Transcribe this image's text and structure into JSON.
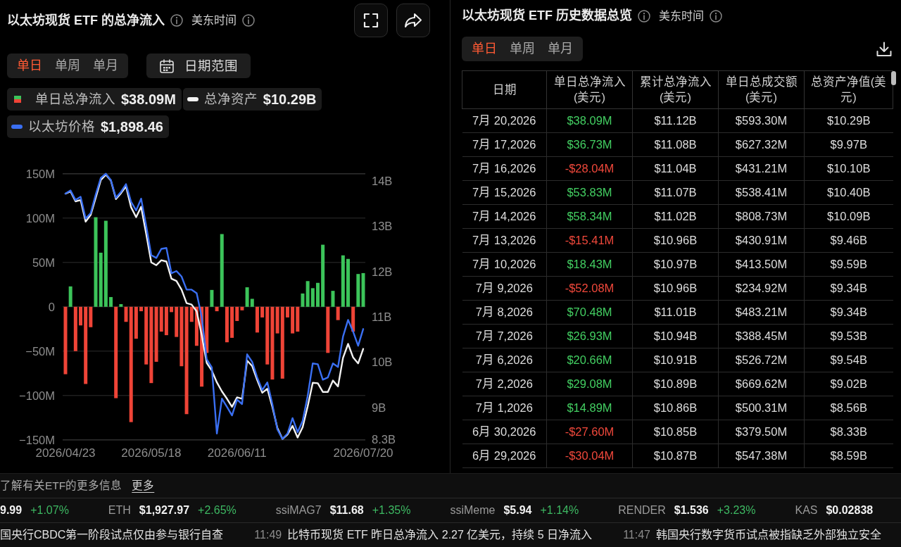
{
  "chart_panel": {
    "title": "以太坊现货 ETF 的总净流入",
    "timezone_label": "美东时间",
    "period_tabs": [
      {
        "label": "单日",
        "selected": true
      },
      {
        "label": "单周",
        "selected": false
      },
      {
        "label": "单月",
        "selected": false
      }
    ],
    "date_range_button": "日期范围",
    "legend": [
      {
        "kind": "bar",
        "label": "单日总净流入",
        "value": "$38.09M"
      },
      {
        "kind": "line",
        "label": "总净资产",
        "value": "$10.29B",
        "color": "#f2f2f2"
      },
      {
        "kind": "line",
        "label": "以太坊价格",
        "value": "$1,898.46",
        "color": "#3a6ff2"
      }
    ],
    "bar_chart": {
      "chart_data": {
        "type": "bar",
        "grid": true,
        "categories": [
          "2026/04/23",
          null,
          null,
          null,
          null,
          null,
          null,
          null,
          null,
          null,
          null,
          null,
          null,
          null,
          null,
          null,
          null,
          "2026/05/18",
          null,
          null,
          null,
          null,
          null,
          null,
          null,
          null,
          null,
          null,
          null,
          null,
          null,
          null,
          null,
          null,
          "2026/06/11",
          null,
          null,
          null,
          null,
          null,
          null,
          null,
          null,
          null,
          null,
          null,
          null,
          null,
          null,
          null,
          null,
          null,
          null,
          null,
          null,
          null,
          null,
          null,
          null,
          "2026/07/20"
        ],
        "ylim": [
          -150,
          150
        ],
        "yticks": [
          {
            "value": 150,
            "label": "150M"
          },
          {
            "value": 100,
            "label": "100M"
          },
          {
            "value": 50,
            "label": "50M"
          },
          {
            "value": 0,
            "label": "0"
          },
          {
            "value": -50,
            "label": "−50M"
          },
          {
            "value": -100,
            "label": "−100M"
          },
          {
            "value": -150,
            "label": "−150M"
          }
        ],
        "series": [
          {
            "color": "#3cc45a",
            "values": [
              null,
              23,
              null,
              null,
              null,
              null,
              101,
              61,
              97,
              11,
              null,
              3,
              null,
              null,
              null,
              null,
              null,
              null,
              null,
              null,
              null,
              null,
              null,
              null,
              null,
              null,
              null,
              null,
              null,
              19,
              null,
              82,
              null,
              null,
              null,
              null,
              22,
              9,
              null,
              null,
              null,
              null,
              null,
              null,
              null,
              null,
              null,
              15,
              29,
              21,
              27,
              70,
              null,
              18,
              null,
              58,
              54,
              null,
              37,
              38
            ]
          },
          {
            "color": "#ef4437",
            "values": [
              -76,
              null,
              -50,
              -21,
              -87,
              -23,
              null,
              null,
              null,
              null,
              -103,
              null,
              -17,
              -130,
              -36,
              -5,
              -65,
              -86,
              -62,
              -28,
              -32,
              -6,
              -34,
              -67,
              -121,
              -17,
              -44,
              -90,
              -52,
              null,
              -5,
              null,
              -40,
              -35,
              -16,
              -4,
              null,
              null,
              -29,
              -12,
              -65,
              -82,
              -30,
              -81,
              -12,
              -30,
              -28,
              null,
              null,
              null,
              null,
              null,
              -52,
              null,
              -15,
              null,
              null,
              -28,
              null,
              null
            ]
          }
        ]
      }
    },
    "line_chart": {
      "chart_data": {
        "type": "line",
        "categories": [
          null,
          null,
          null,
          null,
          null,
          null,
          null,
          null,
          null,
          null,
          null,
          null,
          null,
          null,
          null,
          null,
          null,
          null,
          null,
          null,
          null,
          null,
          null,
          null,
          null,
          null,
          null,
          null,
          null,
          null,
          null,
          null,
          null,
          null,
          null,
          null,
          null,
          null,
          null,
          null,
          null,
          null,
          null,
          null,
          null,
          null,
          null,
          null,
          null,
          null,
          null,
          null,
          null,
          null,
          null,
          null,
          null,
          null,
          null,
          null
        ],
        "ylim": [
          8.28,
          14.16
        ],
        "yticks": [
          {
            "value": 14,
            "label": "14B"
          },
          {
            "value": 13,
            "label": "13B"
          },
          {
            "value": 12,
            "label": "12B"
          },
          {
            "value": 11,
            "label": "11B"
          },
          {
            "value": 10,
            "label": "10B"
          },
          {
            "value": 9,
            "label": "9B"
          },
          {
            "value": 8.3,
            "label": "8.3B"
          }
        ],
        "series": [
          {
            "color": "#f2f2f2",
            "values": [
              13.72,
              13.77,
              13.55,
              13.58,
              13.1,
              13.25,
              13.63,
              14.02,
              14.14,
              14.01,
              13.6,
              13.73,
              13.88,
              13.42,
              13.2,
              13.43,
              12.83,
              12.2,
              12.14,
              12.25,
              12.22,
              11.84,
              11.79,
              11.6,
              11.3,
              11.27,
              11.12,
              10.59,
              9.98,
              9.81,
              9.55,
              9.35,
              9.19,
              9.01,
              9.22,
              9.19,
              10.03,
              9.91,
              9.6,
              9.32,
              9.41,
              9.01,
              8.54,
              8.3,
              8.4,
              8.59,
              8.33,
              8.56,
              9.02,
              9.54,
              9.53,
              9.34,
              9.34,
              9.59,
              9.46,
              10.09,
              10.4,
              10.1,
              9.97,
              10.29
            ]
          },
          {
            "color": "#3a6ff2",
            "values": [
              13.72,
              13.79,
              13.58,
              13.65,
              13.17,
              13.29,
              13.7,
              14.07,
              14.16,
              14.02,
              13.63,
              13.76,
              13.93,
              13.54,
              13.35,
              13.61,
              13.01,
              12.36,
              12.3,
              12.5,
              12.52,
              11.96,
              12.01,
              11.89,
              11.6,
              11.6,
              11.52,
              10.99,
              10.06,
              9.88,
              8.42,
              9.19,
              9.01,
              8.82,
              9.17,
              9.07,
              10.17,
              10.0,
              9.66,
              9.38,
              9.55,
              9.07,
              8.51,
              8.3,
              8.42,
              8.76,
              8.45,
              8.7,
              9.25,
              9.97,
              9.95,
              9.61,
              9.66,
              9.97,
              9.89,
              10.56,
              10.93,
              10.67,
              10.36,
              10.73
            ]
          }
        ]
      }
    }
  },
  "history_panel": {
    "title": "以太坊现货 ETF 历史数据总览",
    "timezone_label": "美东时间",
    "period_tabs": [
      {
        "label": "单日",
        "selected": true
      },
      {
        "label": "单周",
        "selected": false
      },
      {
        "label": "单月",
        "selected": false
      }
    ],
    "table": {
      "columns": [
        "日期",
        "单日总净流入(美元)",
        "累计总净流入(美元)",
        "单日总成交额(美元)",
        "总资产净值(美元)"
      ],
      "rows": [
        {
          "outflow": false,
          "cells": [
            "7月 20,2026",
            "$38.09M",
            "$11.12B",
            "$593.30M",
            "$10.29B"
          ]
        },
        {
          "outflow": false,
          "cells": [
            "7月 17,2026",
            "$36.73M",
            "$11.08B",
            "$627.32M",
            "$9.97B"
          ]
        },
        {
          "outflow": true,
          "cells": [
            "7月 16,2026",
            "-$28.04M",
            "$11.04B",
            "$431.21M",
            "$10.10B"
          ]
        },
        {
          "outflow": false,
          "cells": [
            "7月 15,2026",
            "$53.83M",
            "$11.07B",
            "$538.41M",
            "$10.40B"
          ]
        },
        {
          "outflow": false,
          "cells": [
            "7月 14,2026",
            "$58.34M",
            "$11.02B",
            "$808.73M",
            "$10.09B"
          ]
        },
        {
          "outflow": true,
          "cells": [
            "7月 13,2026",
            "-$15.41M",
            "$10.96B",
            "$430.91M",
            "$9.46B"
          ]
        },
        {
          "outflow": false,
          "cells": [
            "7月 10,2026",
            "$18.43M",
            "$10.97B",
            "$413.50M",
            "$9.59B"
          ]
        },
        {
          "outflow": true,
          "cells": [
            "7月 9,2026",
            "-$52.08M",
            "$10.96B",
            "$234.92M",
            "$9.34B"
          ]
        },
        {
          "outflow": false,
          "cells": [
            "7月 8,2026",
            "$70.48M",
            "$11.01B",
            "$483.21M",
            "$9.34B"
          ]
        },
        {
          "outflow": false,
          "cells": [
            "7月 7,2026",
            "$26.93M",
            "$10.94B",
            "$388.45M",
            "$9.53B"
          ]
        },
        {
          "outflow": false,
          "cells": [
            "7月 6,2026",
            "$20.66M",
            "$10.91B",
            "$526.72M",
            "$9.54B"
          ]
        },
        {
          "outflow": false,
          "cells": [
            "7月 2,2026",
            "$29.08M",
            "$10.89B",
            "$669.62M",
            "$9.02B"
          ]
        },
        {
          "outflow": false,
          "cells": [
            "7月 1,2026",
            "$14.89M",
            "$10.86B",
            "$500.31M",
            "$8.56B"
          ]
        },
        {
          "outflow": true,
          "cells": [
            "6月 30,2026",
            "-$27.60M",
            "$10.85B",
            "$379.50M",
            "$8.33B"
          ]
        },
        {
          "outflow": true,
          "cells": [
            "6月 29,2026",
            "-$30.04M",
            "$10.87B",
            "$547.38M",
            "$8.59B"
          ]
        }
      ]
    }
  },
  "info_bar": {
    "text": "了解有关ETF的更多信息",
    "link": "更多"
  },
  "ticker": [
    {
      "price": "9.99",
      "change": "+1.07%"
    },
    {
      "symbol": "ETH",
      "price": "$1,927.97",
      "change": "+2.65%"
    },
    {
      "symbol": "ssiMAG7",
      "price": "$11.68",
      "change": "+1.35%"
    },
    {
      "symbol": "ssiMeme",
      "price": "$5.94",
      "change": "+1.14%"
    },
    {
      "symbol": "RENDER",
      "price": "$1.536",
      "change": "+3.23%"
    },
    {
      "symbol": "KAS",
      "price": "$0.02838"
    }
  ],
  "news": [
    {
      "text": "国央行CBDC第一阶段试点仅由参与银行自查"
    },
    {
      "time": "11:49",
      "text": "比特币现货 ETF 昨日总净流入 2.27 亿美元，持续 5 日净流入"
    },
    {
      "time": "11:47",
      "text": "韩国央行数字货币试点被指缺乏外部独立安全"
    }
  ]
}
